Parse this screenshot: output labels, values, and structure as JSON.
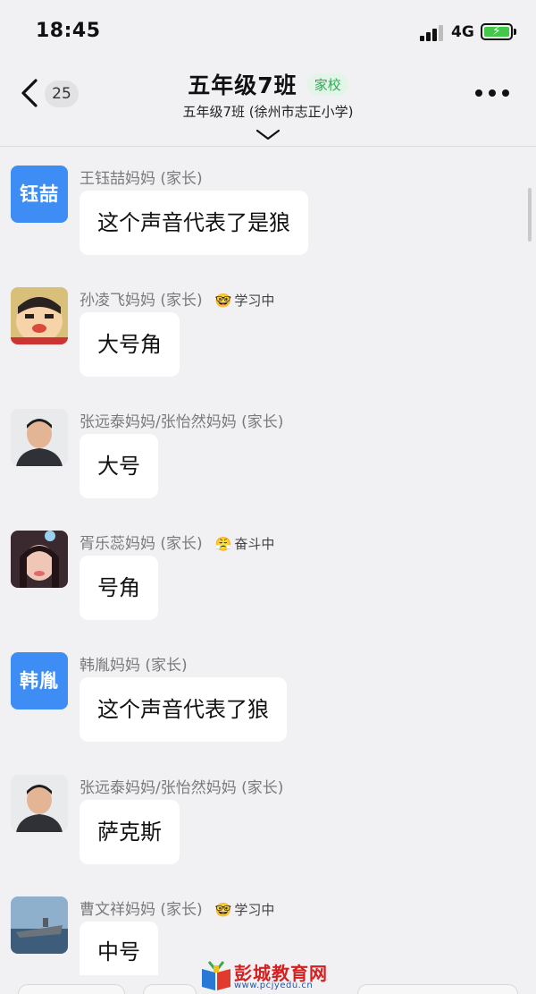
{
  "status_bar": {
    "time": "18:45",
    "network": "4G",
    "battery_level": 1.0,
    "battery_color": "#43c84a"
  },
  "header": {
    "back_count": "25",
    "title": "五年级7班",
    "tag": "家校",
    "subtitle": "五年级7班 (徐州市志正小学)"
  },
  "colors": {
    "accent_blue": "#3d8df5",
    "tag_green": "#2eaa55",
    "background": "#f1f1f3"
  },
  "messages": [
    {
      "avatar_type": "text",
      "avatar_text": "钰喆",
      "sender": "王钰喆妈妈 (家长)",
      "status_icon": "",
      "status": "",
      "text": "这个声音代表了是狼"
    },
    {
      "avatar_type": "cartoon-photo",
      "avatar_text": "",
      "sender": "孙凌飞妈妈 (家长)",
      "status_icon": "glasses-emoji-icon",
      "status": "学习中",
      "text": "大号角"
    },
    {
      "avatar_type": "child-photo",
      "avatar_text": "",
      "sender": "张远泰妈妈/张怡然妈妈 (家长)",
      "status_icon": "",
      "status": "",
      "text": "大号"
    },
    {
      "avatar_type": "girl-photo",
      "avatar_text": "",
      "sender": "胥乐蕊妈妈 (家长)",
      "status_icon": "fighting-emoji-icon",
      "status": "奋斗中",
      "text": "号角"
    },
    {
      "avatar_type": "text",
      "avatar_text": "韩胤",
      "sender": "韩胤妈妈 (家长)",
      "status_icon": "",
      "status": "",
      "text": "这个声音代表了狼"
    },
    {
      "avatar_type": "child-photo",
      "avatar_text": "",
      "sender": "张远泰妈妈/张怡然妈妈 (家长)",
      "status_icon": "",
      "status": "",
      "text": "萨克斯"
    },
    {
      "avatar_type": "ship-photo",
      "avatar_text": "",
      "sender": "曹文祥妈妈 (家长)",
      "status_icon": "glasses-emoji-icon",
      "status": "学习中",
      "text": "中号"
    }
  ],
  "watermark": {
    "title": "彭城教育网",
    "url": "www.pcjyedu.cn"
  }
}
